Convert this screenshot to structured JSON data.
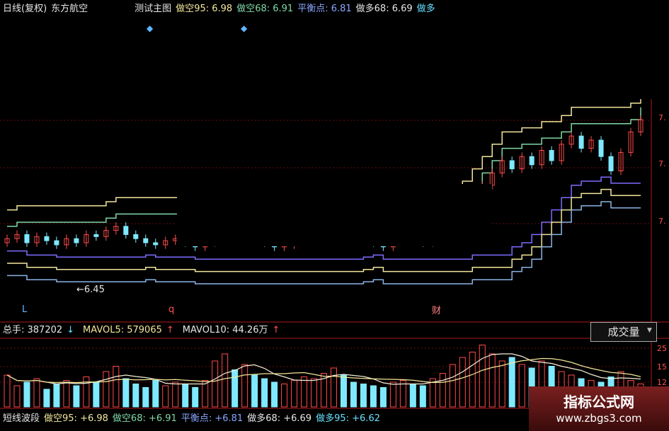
{
  "top_bar": {
    "title_fragment": "日线(复权)",
    "stock_name": "东方航空",
    "indicator_name": "测试主图",
    "short_95": "做空95: 6.98",
    "short_68": "做空68: 6.91",
    "balance": "平衡点: 6.81",
    "long_68": "做多68: 6.69",
    "long_95_fragment": "做多"
  },
  "annotations": {
    "price_label": "←6.45",
    "marker_l": "L",
    "marker_q": "q",
    "marker_cai": "财"
  },
  "price_axis": {
    "tick_upper": "7.",
    "tick_mid": "7.",
    "tick_lower": "7."
  },
  "volume_bar": {
    "total_hands": "总手: 387202",
    "total_hands_arrow": "↓",
    "mavol5": "MAVOL5: 579065",
    "mavol5_arrow": "↑",
    "mavol10": "MAVOL10: 44.26万",
    "mavol10_arrow": "↑",
    "selector_label": "成交量",
    "selector_arrow": "▼"
  },
  "volume_axis": {
    "tick_top": "25",
    "tick_mid": "15",
    "tick_low": "12"
  },
  "bottom_bar": {
    "indicator": "短线波段",
    "short_95": "做空95: +6.98",
    "short_68": "做空68: +6.91",
    "balance": "平衡点: +6.81",
    "long_68": "做多68: +6.69",
    "long_95": "做多95: +6.62"
  },
  "watermark": {
    "title": "指标公式网",
    "url": "www.zbgs3.com"
  },
  "colors": {
    "up": "#ff4a4a",
    "down": "#7fe9ff",
    "band_yellow": "#f2e69a",
    "band_green": "#7fd8a6",
    "band_blue": "#8ab4e6",
    "band_purple": "#7d6bff",
    "ma_white": "#f5efd6",
    "magenta": "#ff33cc",
    "grid": "#6a1010"
  },
  "chart_data": {
    "type": "candlestick",
    "closes": [
      6.72,
      6.74,
      6.7,
      6.73,
      6.71,
      6.69,
      6.72,
      6.7,
      6.74,
      6.73,
      6.76,
      6.78,
      6.74,
      6.72,
      6.7,
      6.69,
      6.71,
      6.72,
      6.7,
      6.68,
      6.7,
      6.73,
      6.75,
      6.72,
      6.74,
      6.71,
      6.7,
      6.68,
      6.69,
      6.72,
      6.74,
      6.75,
      6.78,
      6.8,
      6.77,
      6.74,
      6.72,
      6.7,
      6.68,
      6.71,
      6.73,
      6.72,
      6.7,
      6.74,
      6.76,
      6.8,
      6.86,
      6.92,
      6.98,
      7.04,
      7.1,
      7.06,
      7.12,
      7.08,
      7.15,
      7.1,
      7.18,
      7.22,
      7.16,
      7.2,
      7.12,
      7.05,
      7.14,
      7.24,
      7.3
    ],
    "volumes": [
      180,
      120,
      140,
      160,
      100,
      130,
      150,
      120,
      170,
      140,
      200,
      230,
      160,
      130,
      110,
      150,
      120,
      140,
      130,
      110,
      150,
      260,
      300,
      210,
      240,
      180,
      160,
      140,
      130,
      150,
      170,
      160,
      190,
      220,
      180,
      140,
      130,
      120,
      110,
      140,
      150,
      130,
      120,
      160,
      190,
      240,
      280,
      310,
      350,
      300,
      260,
      280,
      240,
      220,
      260,
      230,
      200,
      180,
      160,
      150,
      140,
      170,
      200,
      150,
      130
    ],
    "mavol5": "579065",
    "mavol10": "44.26万"
  }
}
